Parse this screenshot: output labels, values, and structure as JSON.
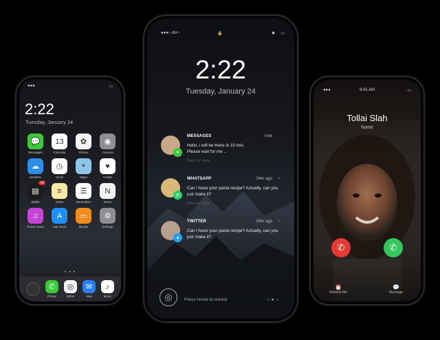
{
  "phone1": {
    "status_time": "",
    "time": "2:22",
    "date": "Tuesday, January 24",
    "apps": [
      {
        "label": "Messages",
        "icon": "messages-icon",
        "color": "#3ec93b",
        "glyph": "💬"
      },
      {
        "label": "Calendar",
        "icon": "calendar-icon",
        "color": "#ffffff",
        "glyph": "13"
      },
      {
        "label": "Photos",
        "icon": "photos-icon",
        "color": "#f4f4f4",
        "glyph": "✿"
      },
      {
        "label": "Camera",
        "icon": "camera-icon",
        "color": "#8e8e93",
        "glyph": "◉"
      },
      {
        "label": "Weather",
        "icon": "weather-icon",
        "color": "#2b8fe6",
        "glyph": "☁"
      },
      {
        "label": "Clock",
        "icon": "clock-icon",
        "color": "#ffffff",
        "glyph": "◷"
      },
      {
        "label": "Maps",
        "icon": "maps-icon",
        "color": "#8cc6e8",
        "glyph": "⌖"
      },
      {
        "label": "Health",
        "icon": "health-icon",
        "color": "#ffffff",
        "glyph": "♥"
      },
      {
        "label": "Wallet",
        "icon": "wallet-icon",
        "color": "#1c1c1e",
        "glyph": "▤",
        "badge": "18"
      },
      {
        "label": "Notes",
        "icon": "notes-icon",
        "color": "#f7e9a3",
        "glyph": "≡"
      },
      {
        "label": "Reminders",
        "icon": "reminders-icon",
        "color": "#ffffff",
        "glyph": "☰"
      },
      {
        "label": "News",
        "icon": "news-icon",
        "color": "#f2f2f2",
        "glyph": "N"
      },
      {
        "label": "iTunes Store",
        "icon": "itunes-icon",
        "color": "#c445d6",
        "glyph": "♫"
      },
      {
        "label": "App Store",
        "icon": "appstore-icon",
        "color": "#1e90f5",
        "glyph": "A"
      },
      {
        "label": "iBooks",
        "icon": "ibooks-icon",
        "color": "#ef8c1e",
        "glyph": "▭"
      },
      {
        "label": "Settings",
        "icon": "settings-icon",
        "color": "#8e8e93",
        "glyph": "⚙"
      }
    ],
    "page_dots": "● ● ●",
    "dock": [
      {
        "label": "Phone",
        "icon": "phone-icon",
        "color": "#3ec93b",
        "glyph": "✆"
      },
      {
        "label": "Safari",
        "icon": "safari-icon",
        "color": "#f4f4f4",
        "glyph": "◎"
      },
      {
        "label": "Mail",
        "icon": "mail-icon",
        "color": "#2a7ff0",
        "glyph": "✉"
      },
      {
        "label": "Music",
        "icon": "music-icon",
        "color": "#ffffff",
        "glyph": "♪"
      }
    ]
  },
  "phone2": {
    "carrier": "du",
    "time": "2:22",
    "date": "Tuesday, January 24",
    "notifications": [
      {
        "title": "MESSAGES",
        "time": "now",
        "body": "Hello, i will be there in 10 min.\nPlease wait for me ..",
        "press": "Press for more",
        "app_color": "#3ec93b",
        "app_glyph": "💬",
        "avatar_color": "#c8a888"
      },
      {
        "title": "WHATSAPP",
        "time": "34m ago",
        "body": "Can I have your pasta recipe? Actually, can you just make it?",
        "press": "Press for more",
        "app_color": "#25d366",
        "app_glyph": "✆",
        "avatar_color": "#d9b97a"
      },
      {
        "title": "TWITTER",
        "time": "34m ago",
        "body": "Can I have your pasta recipe? Actually, can you just make it?",
        "press": "",
        "app_color": "#1da1f2",
        "app_glyph": "🐦",
        "avatar_color": "#b8a090"
      }
    ],
    "unlock_label": "Press home to unlock"
  },
  "phone3": {
    "time": "9:41 AM",
    "caller": "Tollai Slah",
    "caller_sub": "home",
    "decline_color": "#e53935",
    "accept_color": "#34c759",
    "remind_label": "Remind Me",
    "message_label": "Message"
  }
}
